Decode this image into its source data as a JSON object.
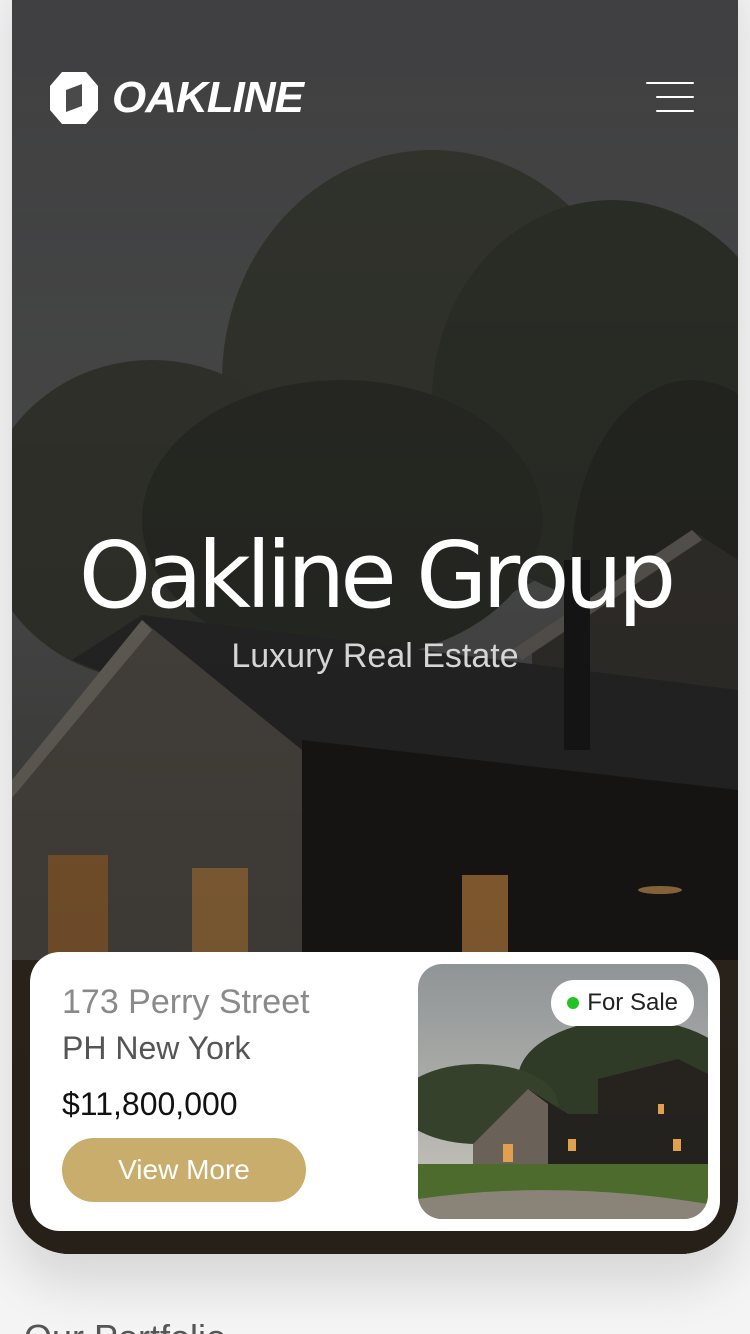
{
  "header": {
    "brand": "OAKLINE",
    "menu_icon": "hamburger-menu-icon",
    "logo_icon": "oakline-hexagon-logo-icon"
  },
  "hero": {
    "title": "Oakline Group",
    "subtitle": "Luxury Real Estate"
  },
  "listing": {
    "address_line1": "173 Perry Street",
    "address_line2": "PH New York",
    "price": "$11,800,000",
    "button_label": "View More",
    "status": "For Sale",
    "status_color": "#22c322"
  },
  "colors": {
    "accent": "#c8ad6c",
    "card_bg": "#ffffff",
    "page_bg": "#f4f4f5"
  },
  "section": {
    "title": "Our Portfolio"
  }
}
